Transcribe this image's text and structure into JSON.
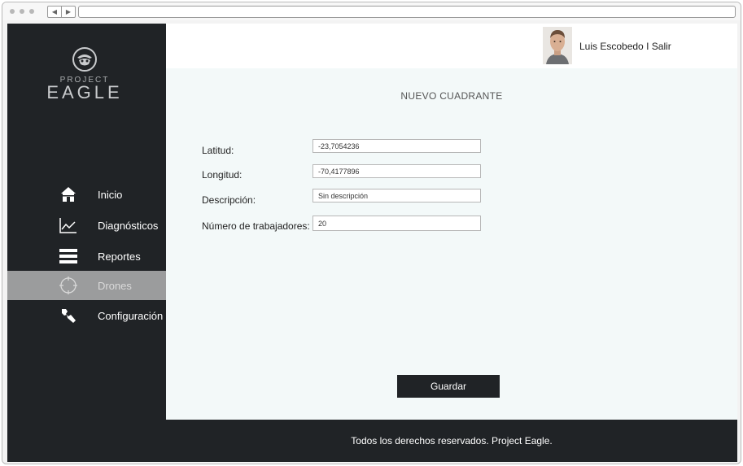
{
  "app": {
    "logo_project": "PROJECT",
    "logo_eagle": "EAGLE"
  },
  "header": {
    "user_name": "Luis Escobedo",
    "separator": "I",
    "logout_label": "Salir"
  },
  "sidebar": {
    "items": [
      {
        "label": "Inicio",
        "icon": "home-icon"
      },
      {
        "label": "Diagnósticos",
        "icon": "chart-icon"
      },
      {
        "label": "Reportes",
        "icon": "list-icon"
      },
      {
        "label": "Drones",
        "icon": "crosshair-icon",
        "active": true
      },
      {
        "label": "Configuración",
        "icon": "wrench-icon"
      }
    ]
  },
  "form": {
    "title": "NUEVO CUADRANTE",
    "fields": [
      {
        "label": "Latitud:",
        "value": "-23,7054236"
      },
      {
        "label": "Longitud:",
        "value": "-70,4177896"
      },
      {
        "label": "Descripción:",
        "value": "Sin descripción"
      },
      {
        "label": "Número de trabajadores:",
        "value": "20"
      }
    ],
    "save_label": "Guardar"
  },
  "footer": {
    "text": "Todos los derechos reservados. Project Eagle."
  },
  "colors": {
    "sidebar_bg": "#202326",
    "active_item_bg": "#9b9c9d",
    "content_bg": "#f3f9f9",
    "button_bg": "#202326"
  }
}
